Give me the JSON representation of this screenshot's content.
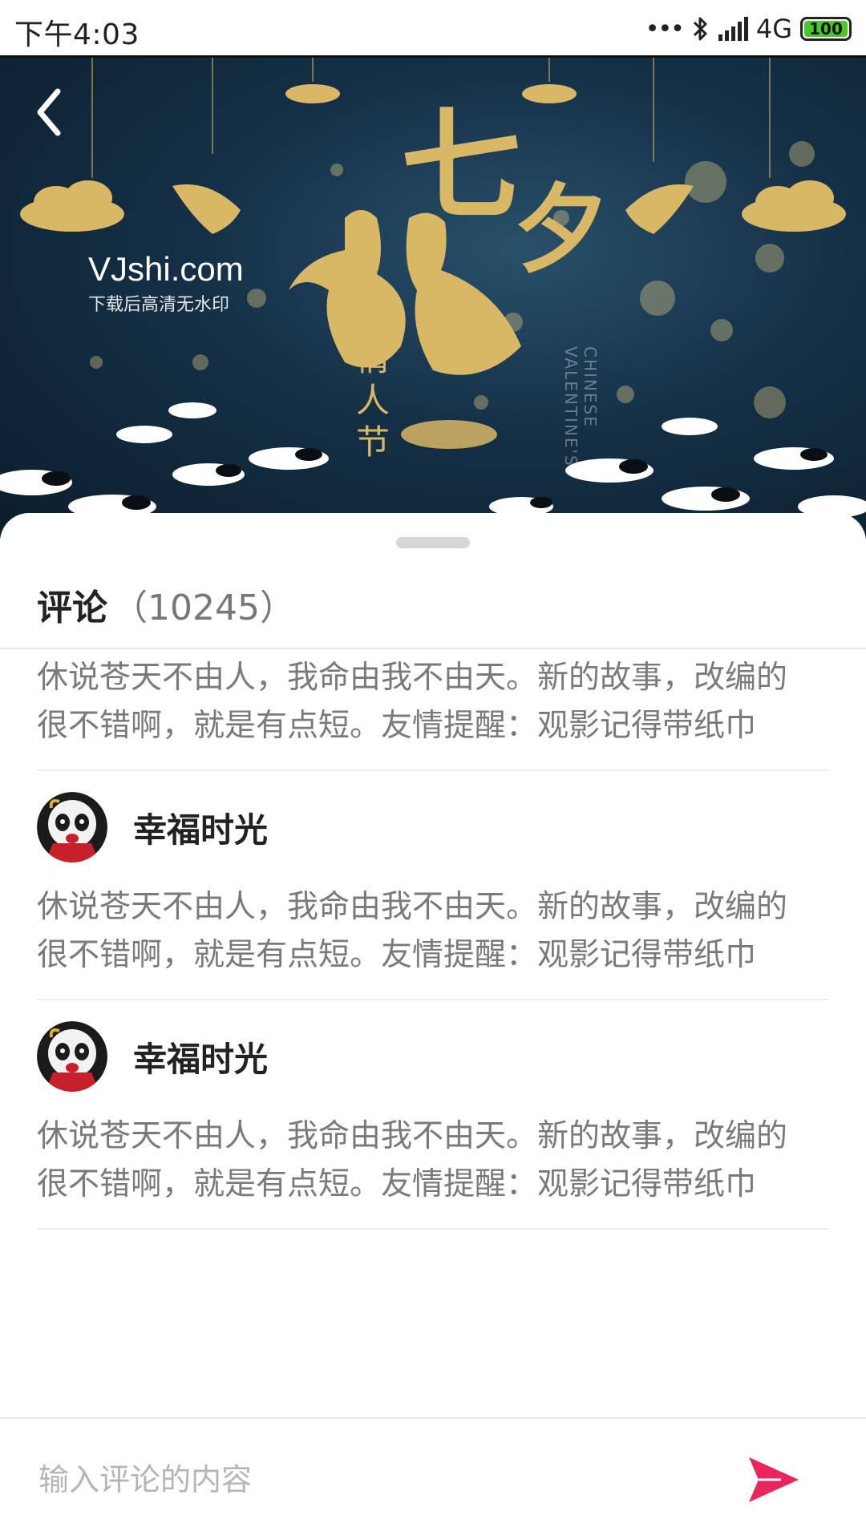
{
  "status_bar": {
    "time": "下午4:03",
    "dots": "•••",
    "network": "4G",
    "battery": "100",
    "battery_level": 1.0,
    "icons": [
      "bluetooth-icon",
      "signal-icon",
      "battery-icon"
    ]
  },
  "hero": {
    "watermark_brand": "VJshi.com",
    "watermark_note": "下载后高清无水印",
    "title_char_1": "七",
    "title_char_2": "夕",
    "vertical_text": "情人节",
    "vertical_en": "CHINESE VALENTINE'S",
    "back_icon": "chevron-left-icon"
  },
  "comments_panel": {
    "title": "评论",
    "count": "（10245）",
    "first_partial_text": "休说苍天不由人，我命由我不由天。新的故事，改编的很不错啊，就是有点短。友情提醒：观影记得带纸巾",
    "items": [
      {
        "username": "幸福时光",
        "text": "休说苍天不由人，我命由我不由天。新的故事，改编的很不错啊，就是有点短。友情提醒：观影记得带纸巾"
      },
      {
        "username": "幸福时光",
        "text": "休说苍天不由人，我命由我不由天。新的故事，改编的很不错啊，就是有点短。友情提醒：观影记得带纸巾"
      }
    ]
  },
  "input_bar": {
    "placeholder": "输入评论的内容",
    "send_icon": "send-icon",
    "accent_color": "#e8255c"
  }
}
